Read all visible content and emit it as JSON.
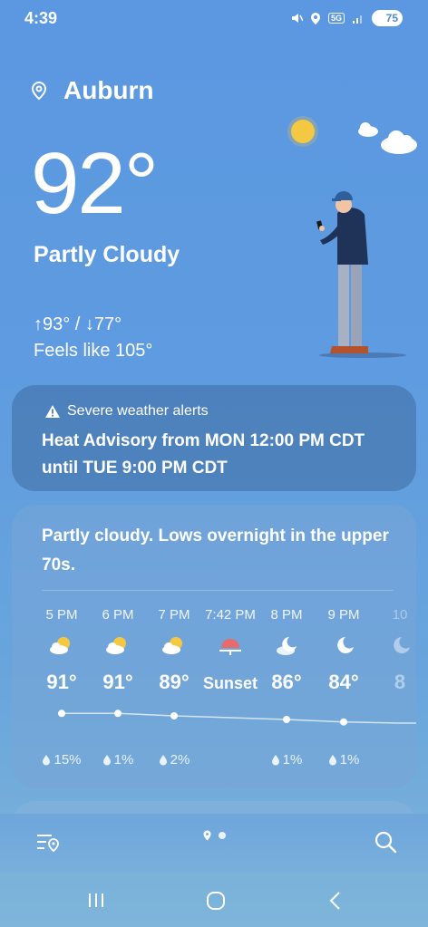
{
  "status": {
    "time": "4:39",
    "network": "5G",
    "battery": "75"
  },
  "location": {
    "city": "Auburn"
  },
  "current": {
    "temp": "92°",
    "condition": "Partly Cloudy",
    "hilo": "↑93° / ↓77°",
    "feels": "Feels like 105°"
  },
  "alert": {
    "header": "Severe weather alerts",
    "body": "Heat Advisory from MON 12:00 PM CDT until TUE 9:00 PM CDT"
  },
  "forecast": {
    "summary": "Partly cloudy. Lows overnight in the upper 70s.",
    "hours": [
      {
        "time": "5 PM",
        "icon": "partly-cloudy-icon",
        "temp": "91°",
        "rain": "15%"
      },
      {
        "time": "6 PM",
        "icon": "partly-cloudy-icon",
        "temp": "91°",
        "rain": "1%"
      },
      {
        "time": "7 PM",
        "icon": "partly-cloudy-icon",
        "temp": "89°",
        "rain": "2%"
      },
      {
        "time": "7:42 PM",
        "icon": "sunset-icon",
        "temp": "Sunset",
        "rain": ""
      },
      {
        "time": "8 PM",
        "icon": "cloudy-moon-icon",
        "temp": "86°",
        "rain": "1%"
      },
      {
        "time": "9 PM",
        "icon": "moon-icon",
        "temp": "84°",
        "rain": "1%"
      },
      {
        "time": "10",
        "icon": "moon-icon",
        "temp": "8",
        "rain": ""
      }
    ],
    "trend_temps": [
      91,
      91,
      89,
      86,
      84,
      83
    ]
  },
  "colors": {
    "accent": "#4d8bd6",
    "sun": "#f5c842",
    "sunset": "#e86a6a"
  }
}
